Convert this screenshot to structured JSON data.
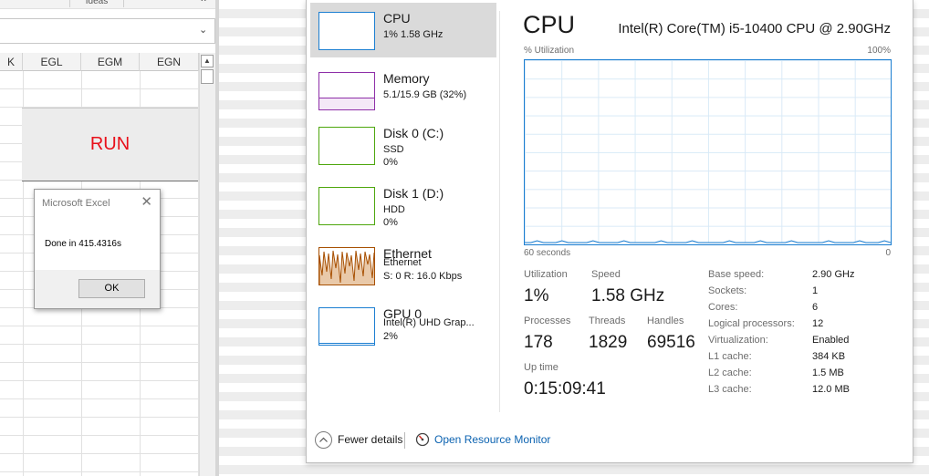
{
  "excel": {
    "ribbon_group_label": "Ideas",
    "ribbon_collapse_glyph": "⌃",
    "formula_dropdown_glyph": "⌄",
    "columns": [
      "K",
      "EGL",
      "EGM",
      "EGN"
    ],
    "run_button_label": "RUN",
    "msgbox": {
      "title": "Microsoft Excel",
      "close_glyph": "✕",
      "message": "Done in 415.4316s",
      "ok_label": "OK"
    }
  },
  "taskmgr": {
    "sidebar": [
      {
        "name": "CPU",
        "sub1": "1% 1.58 GHz",
        "color": "#1b7ed1",
        "kind": "cpu"
      },
      {
        "name": "Memory",
        "sub1": "5.1/15.9 GB (32%)",
        "color": "#8e2fa8",
        "kind": "memory"
      },
      {
        "name": "Disk 0 (C:)",
        "sub1": "SSD",
        "sub2": "0%",
        "color": "#4da60c",
        "kind": "disk"
      },
      {
        "name": "Disk 1 (D:)",
        "sub1": "HDD",
        "sub2": "0%",
        "color": "#4da60c",
        "kind": "disk"
      },
      {
        "name": "Ethernet",
        "sub1": "Ethernet",
        "sub2": "S: 0 R: 16.0 Kbps",
        "color": "#a74f01",
        "kind": "ethernet"
      },
      {
        "name": "GPU 0",
        "sub1": "Intel(R) UHD Grap...",
        "sub2": "2%",
        "color": "#1b7ed1",
        "kind": "gpu"
      }
    ],
    "main": {
      "title": "CPU",
      "model": "Intel(R) Core(TM) i5-10400 CPU @ 2.90GHz",
      "util_label": "% Utilization",
      "util_max": "100%",
      "time_left": "60 seconds",
      "time_right": "0",
      "stats": {
        "utilization_label": "Utilization",
        "utilization": "1%",
        "speed_label": "Speed",
        "speed": "1.58 GHz",
        "processes_label": "Processes",
        "processes": "178",
        "threads_label": "Threads",
        "threads": "1829",
        "handles_label": "Handles",
        "handles": "69516",
        "uptime_label": "Up time",
        "uptime": "0:15:09:41"
      },
      "specs": [
        {
          "label": "Base speed:",
          "value": "2.90 GHz"
        },
        {
          "label": "Sockets:",
          "value": "1"
        },
        {
          "label": "Cores:",
          "value": "6"
        },
        {
          "label": "Logical processors:",
          "value": "12"
        },
        {
          "label": "Virtualization:",
          "value": "Enabled"
        },
        {
          "label": "L1 cache:",
          "value": "384 KB"
        },
        {
          "label": "L2 cache:",
          "value": "1.5 MB"
        },
        {
          "label": "L3 cache:",
          "value": "12.0 MB"
        }
      ],
      "cpu_history_percent": [
        1,
        1,
        2,
        1,
        1,
        1,
        2,
        1,
        1,
        1,
        1,
        2,
        1,
        1,
        1,
        1,
        2,
        1,
        1,
        1,
        1,
        1,
        2,
        1,
        1,
        1,
        1,
        2,
        1,
        1,
        1,
        1,
        1,
        2,
        1,
        1,
        1,
        1,
        2,
        1,
        1,
        1,
        1,
        2,
        1,
        1,
        1,
        1,
        1,
        2,
        1,
        1,
        1,
        1,
        2,
        1,
        1,
        1,
        2,
        1
      ]
    },
    "footer": {
      "fewer_details": "Fewer details",
      "open_resource_monitor": "Open Resource Monitor"
    },
    "colors": {
      "accent": "#1b7ed1",
      "link": "#0b62b0",
      "selected": "#dadada"
    }
  }
}
